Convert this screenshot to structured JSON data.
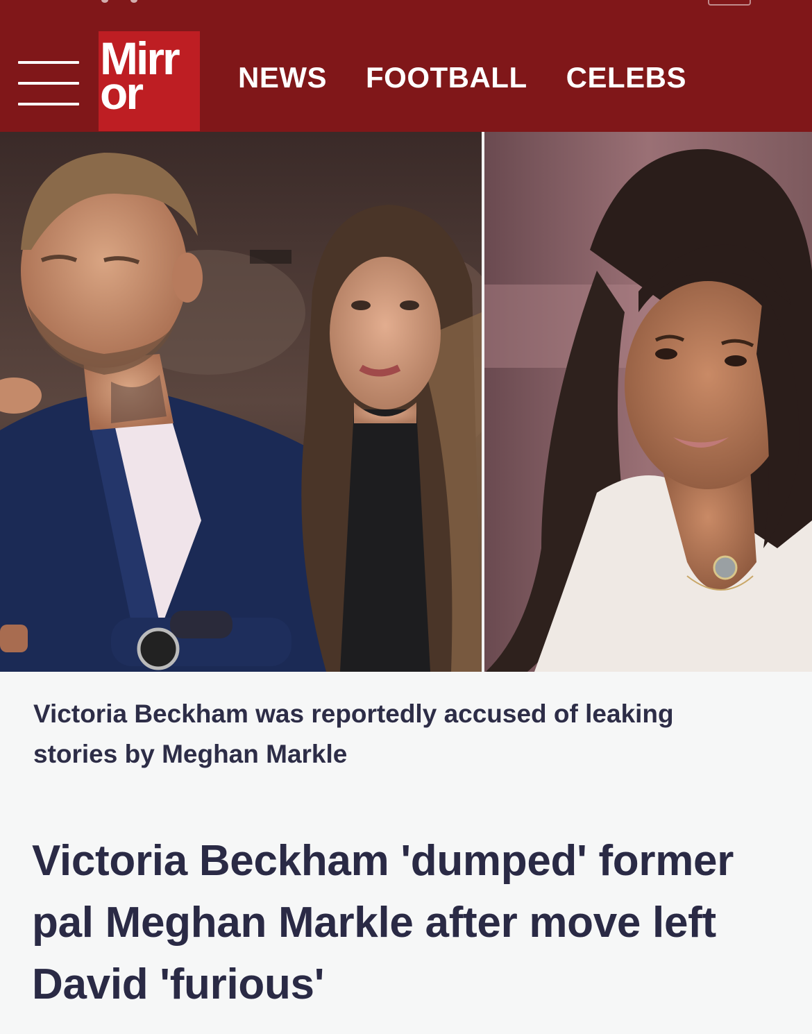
{
  "header": {
    "brand_color": "#801719",
    "logo_color": "#be1e23",
    "logo_text": "Mirr\nor",
    "menu_icon": "hamburger-menu-icon"
  },
  "nav": {
    "items": [
      "NEWS",
      "FOOTBALL",
      "CELEBS"
    ]
  },
  "article": {
    "image_caption": "Victoria Beckham was reportedly accused of leaking stories by Meghan Markle",
    "headline": "Victoria Beckham 'dumped' former pal Meghan Markle after move left David 'furious'"
  },
  "colors": {
    "page_bg": "#f6f7f7",
    "text_dark": "#2a2a45"
  }
}
